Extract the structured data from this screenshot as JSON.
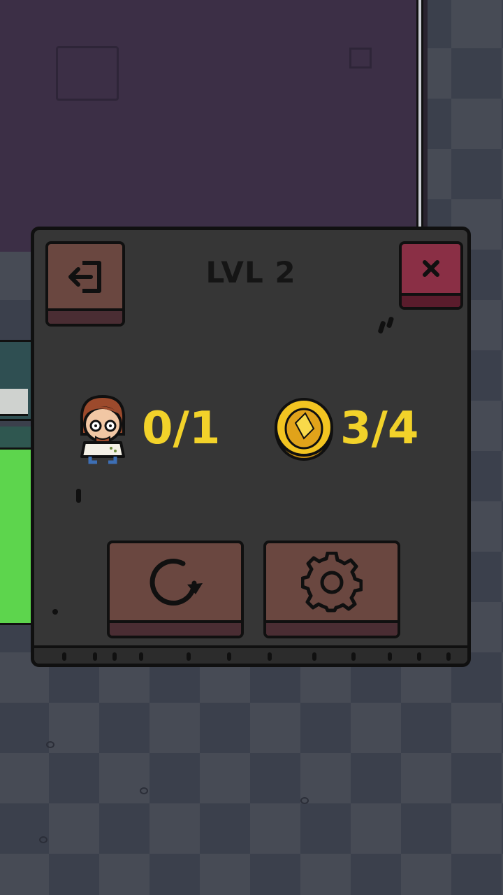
{
  "level": {
    "title": "LVL 2"
  },
  "stats": {
    "scientists": "0/1",
    "coins": "3/4"
  },
  "icons": {
    "exit": "exit-door-icon",
    "close": "close-x-icon",
    "restart": "restart-icon",
    "settings": "gear-icon",
    "scientist": "scientist-character-icon",
    "coin": "gold-coin-icon"
  },
  "colors": {
    "panel": "#363636",
    "button_brown": "#6a4740",
    "button_close": "#8a2f45",
    "stat_yellow": "#f2d22a"
  }
}
